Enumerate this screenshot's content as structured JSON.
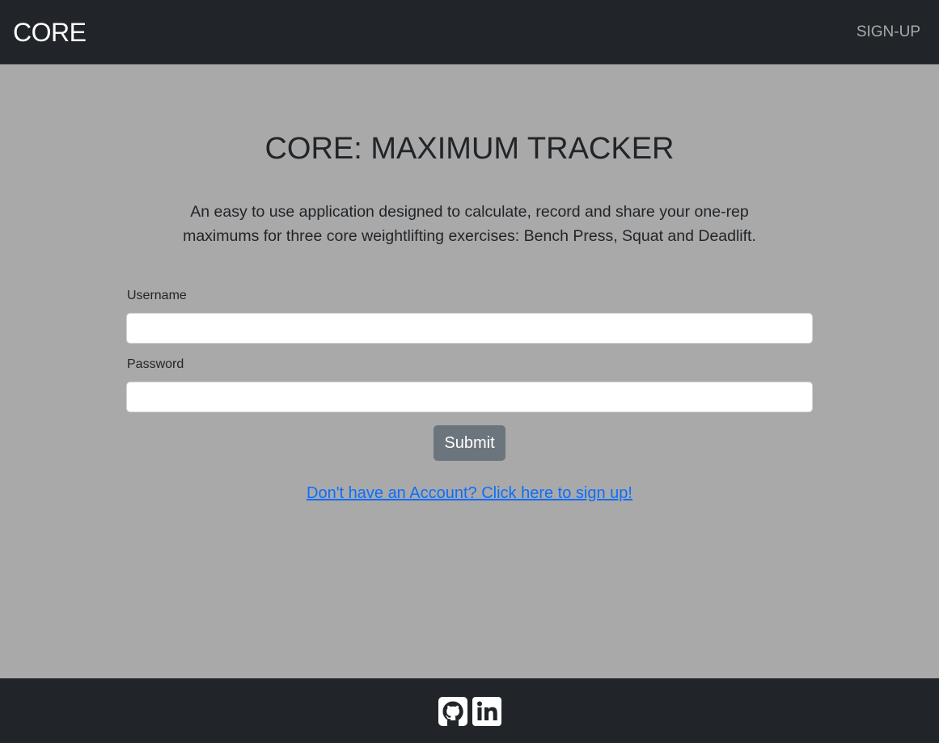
{
  "navbar": {
    "brand": "CORE",
    "signup_link": "SIGN-UP"
  },
  "main": {
    "title": "CORE: MAXIMUM TRACKER",
    "description_line1": "An easy to use application designed to calculate, record and share your one-rep",
    "description_line2": "maximums for three core weightlifting exercises: Bench Press, Squat and Deadlift."
  },
  "form": {
    "username_label": "Username",
    "username_value": "",
    "password_label": "Password",
    "password_value": "",
    "submit_label": "Submit"
  },
  "signup_prompt": "Don't have an Account? Click here to sign up!",
  "footer": {
    "icons": [
      "github-icon",
      "linkedin-icon"
    ]
  },
  "colors": {
    "navbar_bg": "#212529",
    "page_bg": "#a9a9a9",
    "button_bg": "#6c757d",
    "link": "#0d6efd"
  }
}
